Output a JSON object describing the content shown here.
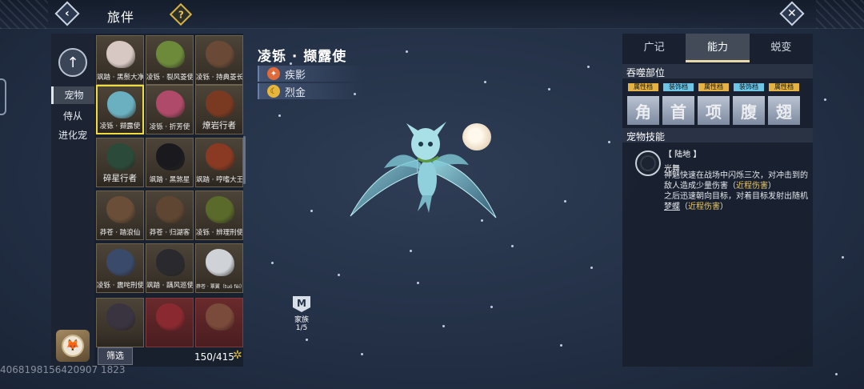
{
  "header": {
    "title": "旅伴",
    "help": "?",
    "back_icon": "‹",
    "close_icon": "✕"
  },
  "categories": [
    {
      "label": "宠物",
      "active": true
    },
    {
      "label": "侍从",
      "active": false
    },
    {
      "label": "进化宠",
      "active": false
    }
  ],
  "pets": [
    {
      "label": "飒踏 · 黑鬃大净",
      "color": "#d8c8c4"
    },
    {
      "label": "凌铄 · 裂风菱使",
      "color": "#6c8a3a"
    },
    {
      "label": "凌铄 · 持典菱长",
      "color": "#6a4a36"
    },
    {
      "label": "凌铄 · 撷露使",
      "color": "#6ab0c0",
      "selected": true
    },
    {
      "label": "凌铄 · 折芳使",
      "color": "#b04a6a"
    },
    {
      "label": "燎岩行者",
      "color": "#7a3a22",
      "big": true
    },
    {
      "label": "碎星行者",
      "color": "#2c4a3a",
      "big": true
    },
    {
      "label": "飒踏 · 黑煞星",
      "color": "#1a1a1e"
    },
    {
      "label": "飒踏 · 哼嗜大王",
      "color": "#8a3a22"
    },
    {
      "label": "莽苍 · 踏浪仙",
      "color": "#6a4e38"
    },
    {
      "label": "莽苍 · 归湖客",
      "color": "#5e4632"
    },
    {
      "label": "凌铄 · 辨理刑使",
      "color": "#5a6a2a"
    },
    {
      "label": "凌铄 · 震咤刑使",
      "color": "#3a4a6a"
    },
    {
      "label": "飒踏 · 蹒风巡使",
      "color": "#2a2a2e"
    },
    {
      "label": "莽苍 · 覃翼（tuó fèi）",
      "color": "#cfd3d8",
      "tiny": true
    },
    {
      "label": "",
      "color": "#3a3440"
    },
    {
      "label": "",
      "color": "#8a2a30",
      "red": true
    },
    {
      "label": "",
      "color": "#7a4a3a",
      "red": true
    }
  ],
  "filter_label": "筛选",
  "count": "150/415",
  "pet": {
    "name": "凌铄 · 撷露使",
    "attributes": [
      {
        "label": "疾影",
        "icon": "fire-icon",
        "color": "#e06a3a"
      },
      {
        "label": "烈金",
        "icon": "moon-icon",
        "color": "#e6b63a"
      }
    ]
  },
  "family": {
    "icon": "M",
    "label": "家族",
    "count": "1/5"
  },
  "uid": "4068198156420907 1823",
  "right_panel": {
    "tabs": [
      {
        "label": "广记",
        "active": false
      },
      {
        "label": "能力",
        "active": true
      },
      {
        "label": "蜕变",
        "active": false
      }
    ],
    "parts_title": "吞噬部位",
    "parts": [
      {
        "badge": "属性档",
        "badge_color": "yellow",
        "char": "角"
      },
      {
        "badge": "装饰档",
        "badge_color": "blue",
        "char": "首"
      },
      {
        "badge": "属性档",
        "badge_color": "yellow",
        "char": "项"
      },
      {
        "badge": "装饰档",
        "badge_color": "blue",
        "char": "腹"
      },
      {
        "badge": "属性档",
        "badge_color": "yellow",
        "char": "翅"
      }
    ],
    "skills_title": "宠物技能",
    "skill": {
      "tag": "【 陆地 】",
      "name": "光舞",
      "desc_1": "神魅快速在战场中闪烁三次，对冲击到的敌人造成少量伤害（",
      "desc_1_hl": "近程伤害",
      "desc_1_end": "）",
      "desc_2": "之后迅速朝向目标，对着目标发射出随机",
      "desc_2_ul": "梦蝶",
      "desc_2_mid": "（",
      "desc_2_hl": "近程伤害",
      "desc_2_end": "）"
    }
  }
}
